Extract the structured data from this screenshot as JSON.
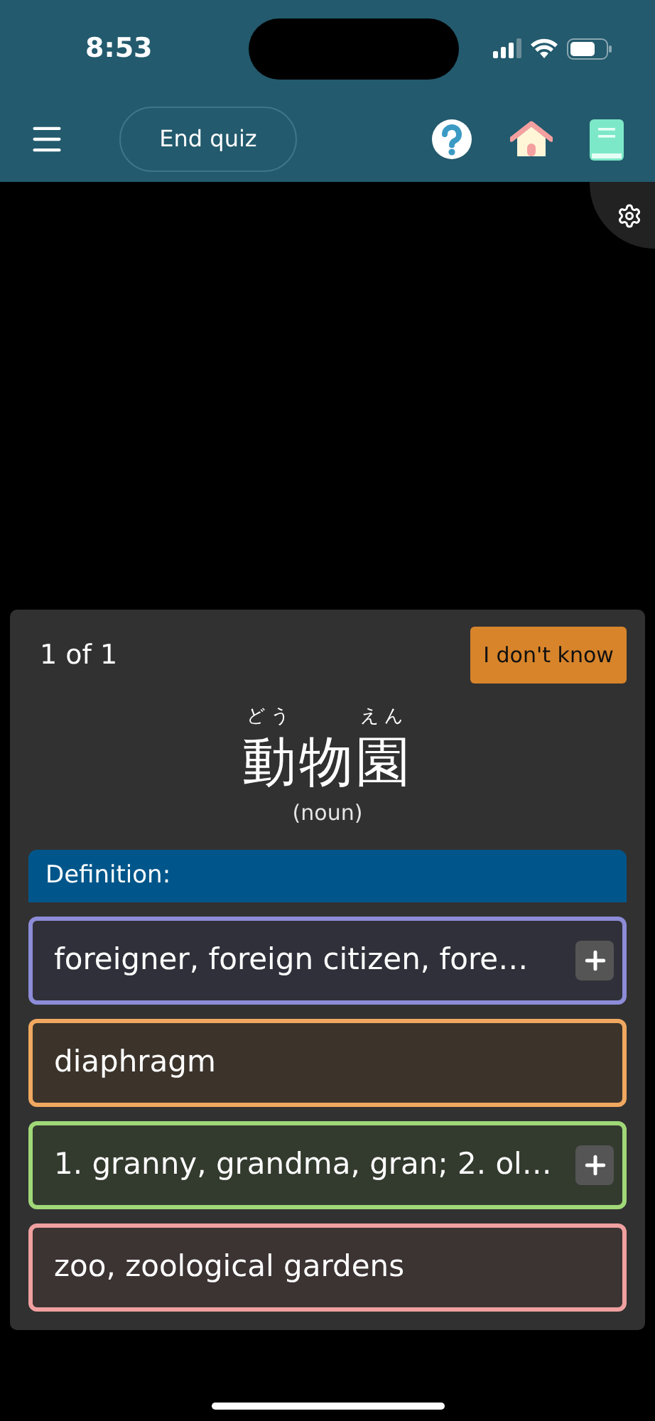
{
  "status_bar": {
    "time": "8:53"
  },
  "toolbar": {
    "end_button": "End quiz"
  },
  "quiz": {
    "progress": "1 of 1",
    "skip_button": "I don't know",
    "word": [
      {
        "kanji": "動",
        "reading": "どう"
      },
      {
        "kanji": "物"
      },
      {
        "kanji": "園",
        "reading": "えん"
      }
    ],
    "part_of_speech": "(noun)",
    "definition_label": "Definition:",
    "options": [
      {
        "text": "foreigner, foreign citizen, fore…",
        "color": "#8c8cd8",
        "expandable": true
      },
      {
        "text": "diaphragm",
        "color": "#f0a860",
        "expandable": false
      },
      {
        "text": "1. granny, grandma, gran; 2. ol…",
        "color": "#a0d878",
        "expandable": true
      },
      {
        "text": "zoo, zoological gardens",
        "color": "#f0a0a0",
        "expandable": false
      }
    ]
  }
}
